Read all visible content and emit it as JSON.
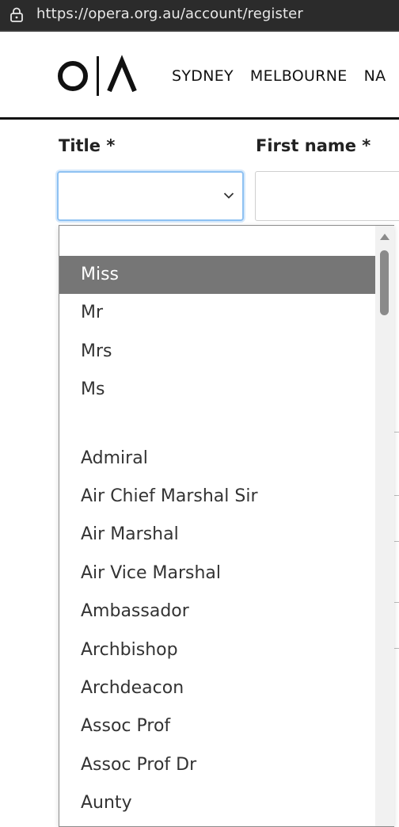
{
  "browser": {
    "url": "https://opera.org.au/account/register"
  },
  "header": {
    "logo_text": "O|A",
    "nav": [
      "SYDNEY",
      "MELBOURNE",
      "NA"
    ]
  },
  "form": {
    "title_label": "Title *",
    "first_name_label": "First name *",
    "title_value": "",
    "first_name_value": ""
  },
  "dropdown": {
    "selected": "Miss",
    "options": [
      "Miss",
      "Mr",
      "Mrs",
      "Ms",
      "",
      "Admiral",
      "Air Chief Marshal Sir",
      "Air Marshal",
      "Air Vice Marshal",
      "Ambassador",
      "Archbishop",
      "Archdeacon",
      "Assoc Prof",
      "Assoc Prof Dr",
      "Aunty"
    ]
  },
  "colors": {
    "accent_focus": "#8ec1f2",
    "selected_bg": "#767676",
    "url_bar": "#2b2b2b"
  }
}
